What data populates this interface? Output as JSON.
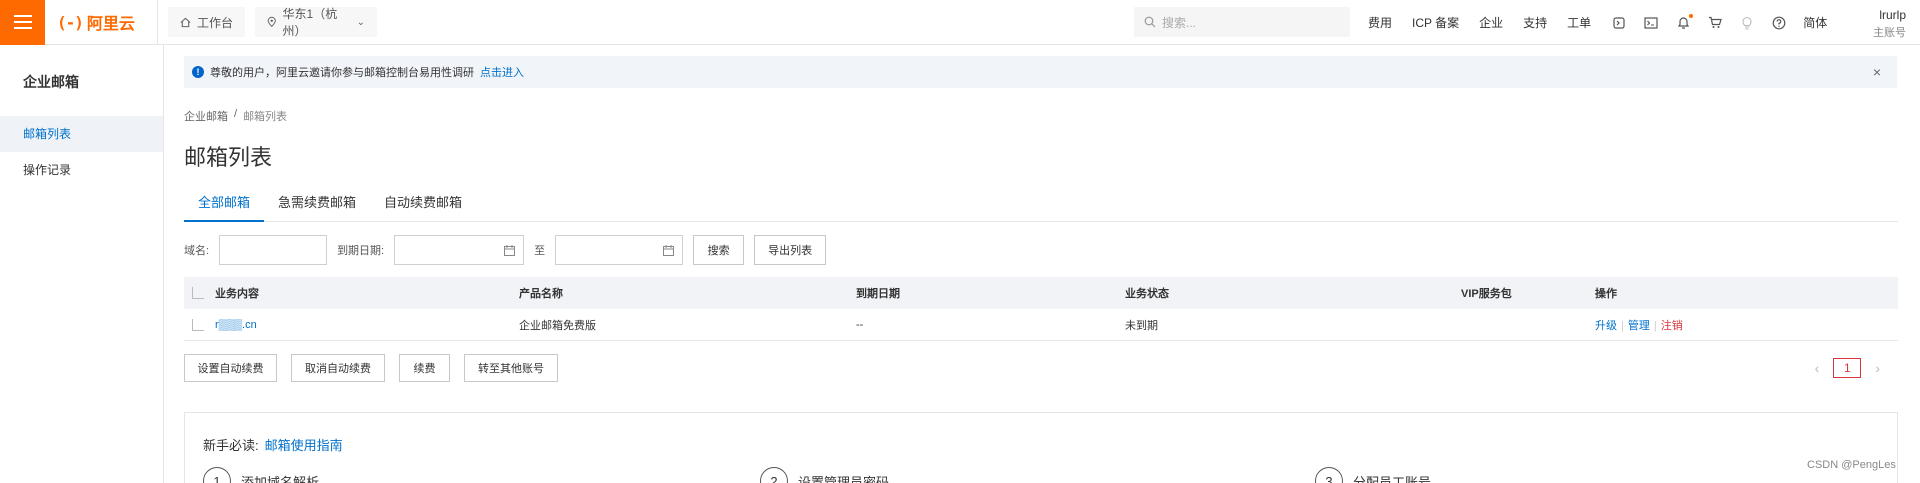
{
  "header": {
    "logo_mark": "(-)",
    "logo_text": "阿里云",
    "workbench_label": "工作台",
    "region_label": "华东1（杭州）",
    "search_placeholder": "搜索...",
    "links": [
      "费用",
      "ICP 备案",
      "企业",
      "支持",
      "工单"
    ],
    "lang_label": "简体",
    "user_name": "lrurlp",
    "user_role": "主账号"
  },
  "sidebar": {
    "title": "企业邮箱",
    "items": [
      {
        "label": "邮箱列表",
        "active": true
      },
      {
        "label": "操作记录",
        "active": false
      }
    ]
  },
  "notice": {
    "message": "尊敬的用户，阿里云邀请你参与邮箱控制台易用性调研",
    "link": "点击进入",
    "close": "×"
  },
  "breadcrumb": {
    "root": "企业邮箱",
    "sep": "/",
    "current": "邮箱列表"
  },
  "page_title": "邮箱列表",
  "tabs": [
    {
      "label": "全部邮箱",
      "active": true
    },
    {
      "label": "急需续费邮箱",
      "active": false
    },
    {
      "label": "自动续费邮箱",
      "active": false
    }
  ],
  "filters": {
    "domain_label": "域名:",
    "expire_label": "到期日期:",
    "to_label": "至",
    "search_button": "搜索",
    "export_button": "导出列表"
  },
  "table": {
    "headers": [
      "业务内容",
      "产品名称",
      "到期日期",
      "业务状态",
      "VIP服务包",
      "操作"
    ],
    "rows": [
      {
        "domain": "r▒▒▒.cn",
        "product": "企业邮箱免费版",
        "expire": "--",
        "status": "未到期",
        "vip": "",
        "actions": [
          "升级",
          "管理",
          "注销"
        ]
      }
    ]
  },
  "bulk_actions": [
    "设置自动续费",
    "取消自动续费",
    "续费",
    "转至其他账号"
  ],
  "pagination": {
    "prev": "‹",
    "current": "1",
    "next": "›"
  },
  "guide": {
    "title": "新手必读:",
    "link": "邮箱使用指南",
    "steps": [
      {
        "num": "1",
        "label": "添加域名解析"
      },
      {
        "num": "2",
        "label": "设置管理员密码"
      },
      {
        "num": "3",
        "label": "分配员工账号"
      }
    ]
  },
  "watermark": "CSDN @PengLes",
  "colors": {
    "brand": "#ff6a00",
    "link": "#0070cc",
    "danger": "#d9363e"
  }
}
